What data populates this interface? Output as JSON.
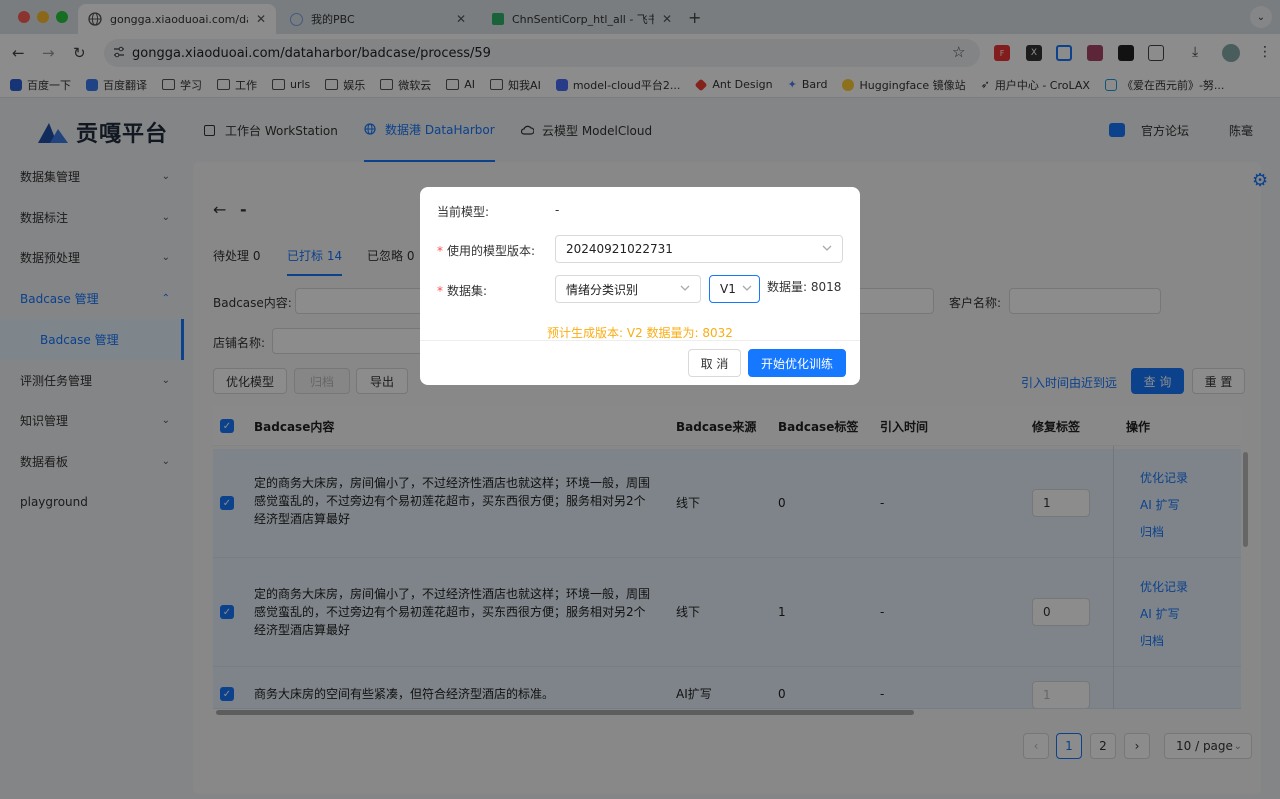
{
  "browser": {
    "tabs": [
      {
        "title": "gongga.xiaoduoai.com/datah",
        "active": true
      },
      {
        "title": "我的PBC",
        "active": false
      },
      {
        "title": "ChnSentiCorp_htl_all - 飞书云",
        "active": false
      }
    ],
    "url": "gongga.xiaoduoai.com/dataharbor/badcase/process/59",
    "bookmarks": [
      "百度一下",
      "百度翻译",
      "学习",
      "工作",
      "urls",
      "娱乐",
      "微软云",
      "AI",
      "知我AI",
      "model-cloud平台2...",
      "Ant Design",
      "Bard",
      "Huggingface 镜像站",
      "用户中心 - CroLAX",
      "《爱在西元前》-努..."
    ]
  },
  "app": {
    "logo": "贡嘎平台",
    "nav": [
      {
        "label": "工作台 WorkStation",
        "active": false
      },
      {
        "label": "数据港 DataHarbor",
        "active": true
      },
      {
        "label": "云模型 ModelCloud",
        "active": false
      }
    ],
    "forum": "官方论坛",
    "user": "陈毫"
  },
  "sidebar": {
    "items": [
      {
        "label": "数据集管理"
      },
      {
        "label": "数据标注"
      },
      {
        "label": "数据预处理"
      },
      {
        "label": "Badcase 管理"
      },
      {
        "label": "Badcase 管理"
      },
      {
        "label": "评测任务管理"
      },
      {
        "label": "知识管理"
      },
      {
        "label": "数据看板"
      },
      {
        "label": "playground"
      }
    ]
  },
  "page": {
    "back_title": "-",
    "tabs": [
      "待处理 0",
      "已打标 14",
      "已忽略 0"
    ],
    "filters": {
      "badcase_content_label": "Badcase内容:",
      "customer_label": "客户名称:",
      "shop_label": "店铺名称:"
    },
    "actions": {
      "optimize": "优化模型",
      "archive": "归档",
      "export": "导出",
      "sort": "引入时间由近到远",
      "query": "查 询",
      "reset": "重 置"
    },
    "table": {
      "columns": [
        "Badcase内容",
        "Badcase来源",
        "Badcase标签",
        "引入时间",
        "修复标签",
        "操作"
      ],
      "rows": [
        {
          "content": "定的商务大床房，房间偏小了，不过经济性酒店也就这样；环境一般，周围感觉蛮乱的，不过旁边有个易初莲花超市，买东西很方便；服务相对另2个经济型酒店算最好",
          "source": "线下",
          "label": "0",
          "time": "-",
          "fix": "1",
          "ops": [
            "优化记录",
            "AI 扩写",
            "归档"
          ]
        },
        {
          "content": "定的商务大床房，房间偏小了，不过经济性酒店也就这样；环境一般，周围感觉蛮乱的，不过旁边有个易初莲花超市，买东西很方便；服务相对另2个经济型酒店算最好",
          "source": "线下",
          "label": "1",
          "time": "-",
          "fix": "0",
          "ops": [
            "优化记录",
            "AI 扩写",
            "归档"
          ]
        },
        {
          "content": "商务大床房的空间有些紧凑，但符合经济型酒店的标准。",
          "source": "AI扩写",
          "label": "0",
          "time": "-",
          "fix": "1",
          "ops": []
        }
      ]
    },
    "pagination": {
      "pages": [
        "1",
        "2"
      ],
      "current": "1",
      "page_size": "10 / page"
    }
  },
  "modal": {
    "current_model_label": "当前模型:",
    "current_model_value": "-",
    "model_version_label": "使用的模型版本:",
    "model_version_value": "20240921022731",
    "dataset_label": "数据集:",
    "dataset_value": "情绪分类识别",
    "dataset_version": "V1",
    "data_count": "数据量: 8018",
    "hint": "预计生成版本: V2  数据量为: 8032",
    "cancel": "取 消",
    "confirm": "开始优化训练"
  },
  "colors": {
    "primary": "#1677ff",
    "warning": "#faad14",
    "required": "#ff4d4f"
  }
}
